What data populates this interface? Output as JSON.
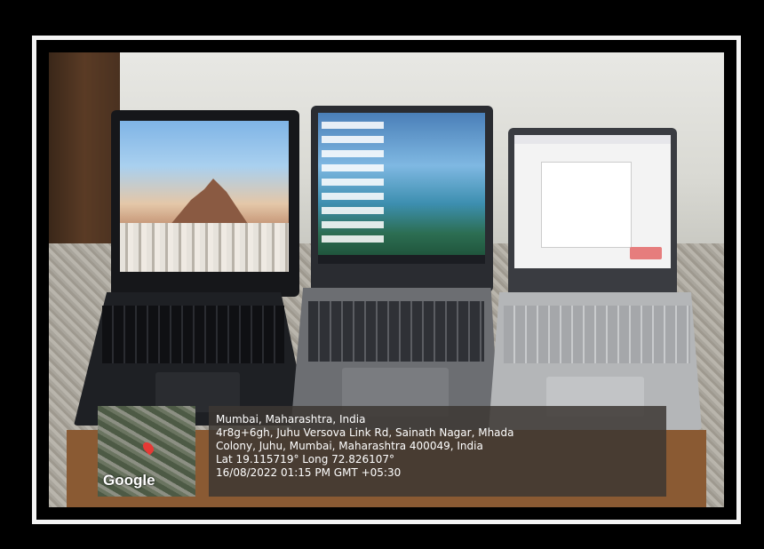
{
  "photo": {
    "logo_text": "Google",
    "location_line": "Mumbai, Maharashtra, India",
    "address_line1": "4r8g+6gh, Juhu Versova Link Rd, Sainath Nagar, Mhada",
    "address_line2": "Colony, Juhu, Mumbai, Maharashtra 400049, India",
    "coordinates": "Lat 19.115719° Long 72.826107°",
    "timestamp": "16/08/2022 01:15 PM GMT +05:30"
  }
}
